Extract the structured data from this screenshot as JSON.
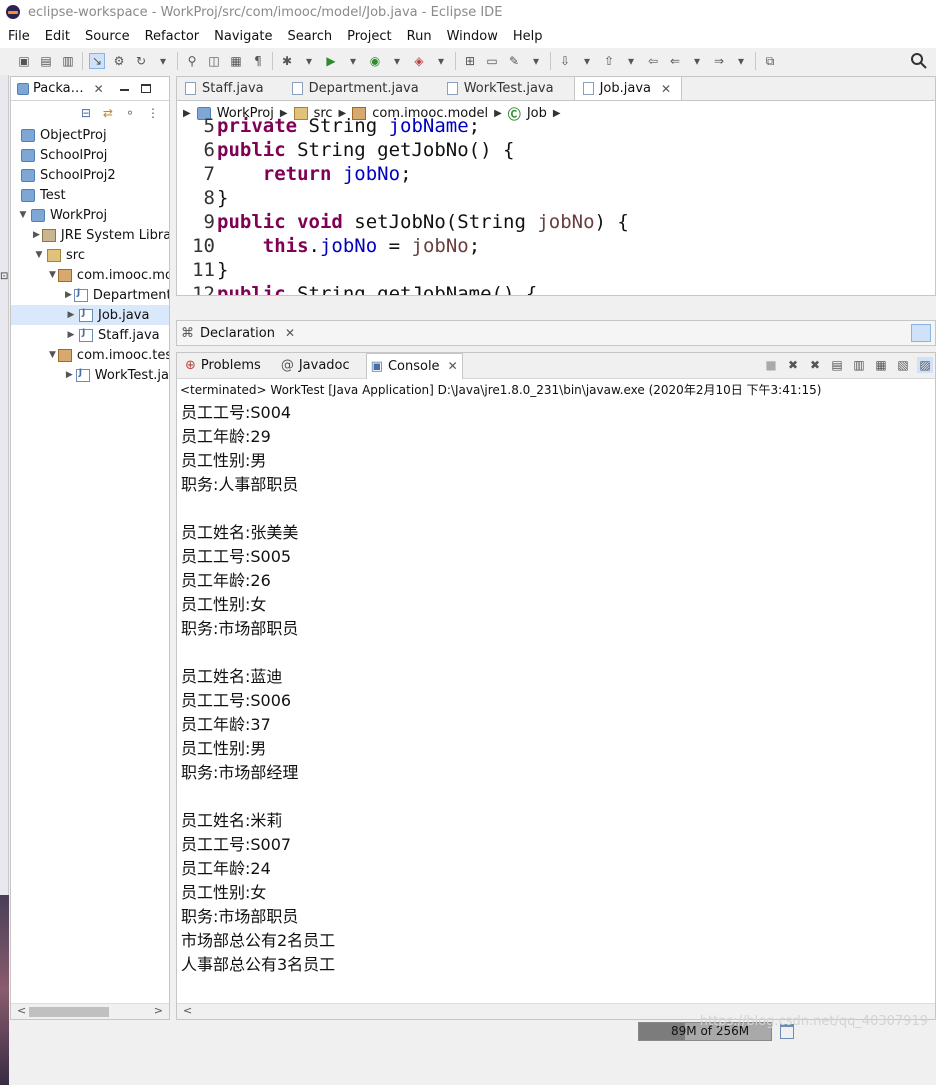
{
  "window": {
    "title": "eclipse-workspace - WorkProj/src/com/imooc/model/Job.java - Eclipse IDE"
  },
  "menu": [
    "File",
    "Edit",
    "Source",
    "Refactor",
    "Navigate",
    "Search",
    "Project",
    "Run",
    "Window",
    "Help"
  ],
  "package_explorer": {
    "tab_label": "Packa…",
    "items": [
      {
        "label": "ObjectProj",
        "icon": "project-icon"
      },
      {
        "label": "SchoolProj",
        "icon": "project-icon"
      },
      {
        "label": "SchoolProj2",
        "icon": "project-icon"
      },
      {
        "label": "Test",
        "icon": "project-icon"
      },
      {
        "label": "WorkProj",
        "icon": "project-icon"
      },
      {
        "label": "JRE System Libra",
        "icon": "library-icon"
      },
      {
        "label": "src",
        "icon": "source-folder-icon"
      },
      {
        "label": "com.imooc.mo",
        "icon": "package-icon"
      },
      {
        "label": "Department",
        "icon": "java-file-icon"
      },
      {
        "label": "Job.java",
        "icon": "java-file-icon"
      },
      {
        "label": "Staff.java",
        "icon": "java-file-icon"
      },
      {
        "label": "com.imooc.tes",
        "icon": "package-icon"
      },
      {
        "label": "WorkTest.ja",
        "icon": "java-file-icon"
      }
    ]
  },
  "editor": {
    "tabs": [
      "Staff.java",
      "Department.java",
      "WorkTest.java",
      "Job.java"
    ],
    "active_tab": "Job.java",
    "breadcrumb": [
      "WorkProj",
      "src",
      "com.imooc.model",
      "Job"
    ],
    "lines": [
      {
        "num": "5",
        "text": "private String jobName;"
      },
      {
        "num": "6",
        "text": "public String getJobNo() {"
      },
      {
        "num": "7",
        "text": "    return jobNo;"
      },
      {
        "num": "8",
        "text": "}"
      },
      {
        "num": "9",
        "text": "public void setJobNo(String jobNo) {"
      },
      {
        "num": "10",
        "text": "    this.jobNo = jobNo;"
      },
      {
        "num": "11",
        "text": "}"
      },
      {
        "num": "12",
        "text": "public String getJobName() {"
      }
    ]
  },
  "declaration": {
    "label": "Declaration"
  },
  "console": {
    "tabs": [
      "Problems",
      "Javadoc",
      "Console"
    ],
    "terminated": "<terminated> WorkTest [Java Application] D:\\Java\\jre1.8.0_231\\bin\\javaw.exe (2020年2月10日 下午3:41:15)",
    "output": [
      "员工工号:S004",
      "员工年龄:29",
      "员工性别:男",
      "职务:人事部职员",
      "",
      "员工姓名:张美美",
      "员工工号:S005",
      "员工年龄:26",
      "员工性别:女",
      "职务:市场部职员",
      "",
      "员工姓名:蓝迪",
      "员工工号:S006",
      "员工年龄:37",
      "员工性别:男",
      "职务:市场部经理",
      "",
      "员工姓名:米莉",
      "员工工号:S007",
      "员工年龄:24",
      "员工性别:女",
      "职务:市场部职员",
      "市场部总公有2名员工",
      "人事部总公有3名员工"
    ]
  },
  "status": {
    "memory": "89M of 256M",
    "memory_used_fraction": 0.35
  },
  "watermark": "https://blog.csdn.net/qq_40307919"
}
